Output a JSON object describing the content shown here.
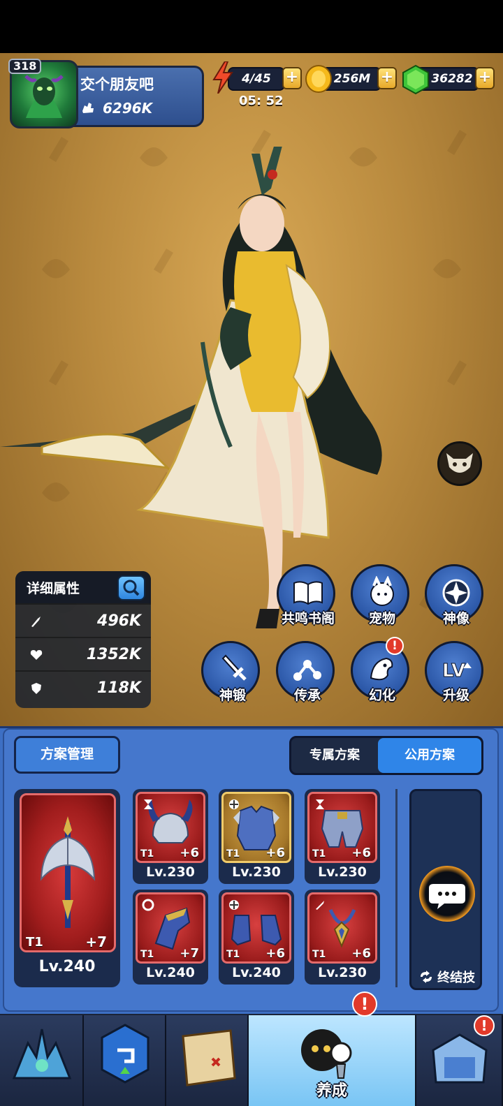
{
  "header": {
    "player_level": "318",
    "player_name": "交个朋友吧",
    "power": "6296K",
    "stamina": "4/45",
    "stamina_timer": "05: 52",
    "gold": "256M",
    "gems": "36282",
    "plus_label": "+"
  },
  "stats": {
    "title": "详细属性",
    "attack": "496K",
    "hp": "1352K",
    "defense": "118K"
  },
  "actions": {
    "row1": [
      {
        "label": "共鸣书阁",
        "icon": "book-icon"
      },
      {
        "label": "宠物",
        "icon": "pet-icon"
      },
      {
        "label": "神像",
        "icon": "statue-icon"
      }
    ],
    "row2": [
      {
        "label": "神锻",
        "icon": "sword-icon"
      },
      {
        "label": "传承",
        "icon": "inherit-icon"
      },
      {
        "label": "幻化",
        "icon": "transform-icon"
      },
      {
        "label": "升级",
        "icon": "level-up-icon"
      }
    ],
    "alert": "!"
  },
  "equipment": {
    "manage_label": "方案管理",
    "tab_exclusive": "专属方案",
    "tab_public": "公用方案",
    "weapon": {
      "tier": "T1",
      "plus": "+7",
      "level": "Lv.240"
    },
    "items": [
      {
        "tier": "T1",
        "plus": "+6",
        "level": "Lv.230"
      },
      {
        "tier": "T1",
        "plus": "+6",
        "level": "Lv.230"
      },
      {
        "tier": "T1",
        "plus": "+6",
        "level": "Lv.230"
      },
      {
        "tier": "T1",
        "plus": "+7",
        "level": "Lv.240"
      },
      {
        "tier": "T1",
        "plus": "+6",
        "level": "Lv.240"
      },
      {
        "tier": "T1",
        "plus": "+6",
        "level": "Lv.230"
      }
    ],
    "ultimate_label": "终结技"
  },
  "nav": {
    "active_label": "养成"
  },
  "colors": {
    "panel_blue": "#4577cc",
    "accent_blue": "#2f85e8",
    "equip_red": "#a11d1d",
    "equip_gold": "#a47629",
    "alert_red": "#e23a2a"
  }
}
